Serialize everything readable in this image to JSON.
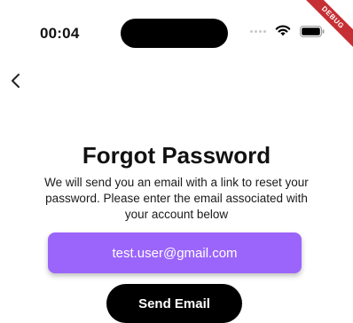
{
  "status_bar": {
    "time": "00:04",
    "wifi_icon": "wifi-icon",
    "battery_icon": "battery-icon"
  },
  "debug_banner": {
    "label": "DEBUG",
    "color": "#c62f33"
  },
  "nav": {
    "back_icon": "chevron-left-icon"
  },
  "content": {
    "title": "Forgot Password",
    "description": "We will send you an email with a link to reset your password. Please enter the email associated with your account below",
    "email_value": "test.user@gmail.com",
    "send_button_label": "Send Email"
  },
  "colors": {
    "accent": "#9b65fb",
    "button_bg": "#000000",
    "text": "#111111"
  }
}
